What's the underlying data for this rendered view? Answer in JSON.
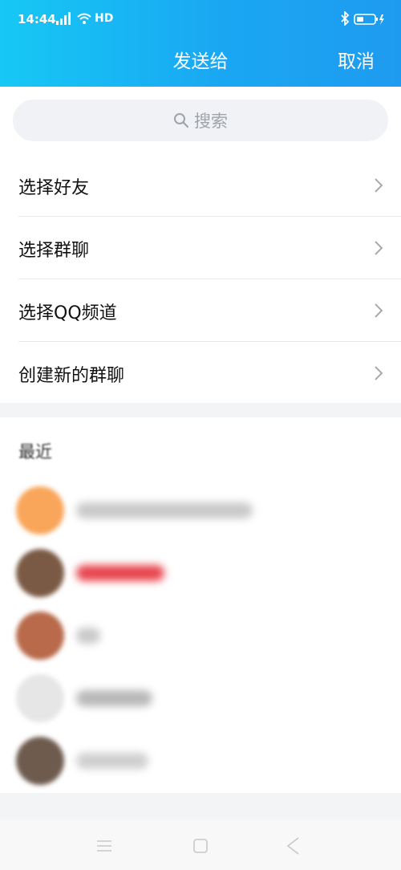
{
  "status_bar": {
    "time": "14:44",
    "network": "HD",
    "icons": [
      "signal-icon",
      "wifi-icon",
      "bluetooth-icon",
      "battery-icon",
      "charging-icon"
    ]
  },
  "header": {
    "title": "发送给",
    "cancel_label": "取消"
  },
  "search": {
    "placeholder": "搜索",
    "icon": "search-icon"
  },
  "menu": {
    "items": [
      {
        "label": "选择好友",
        "icon": "chevron-right-icon"
      },
      {
        "label": "选择群聊",
        "icon": "chevron-right-icon"
      },
      {
        "label": "选择QQ频道",
        "icon": "chevron-right-icon"
      },
      {
        "label": "创建新的群聊",
        "icon": "chevron-right-icon"
      }
    ]
  },
  "recent": {
    "title": "最近",
    "contacts_blurred": true,
    "avatar_colors": [
      "#f9a65a",
      "#7a5a44",
      "#b86a4a",
      "#d8d8d8",
      "#6e5b4e"
    ],
    "accent_color": "#e8464f"
  },
  "colors": {
    "header_gradient_start": "#16c8f5",
    "header_gradient_end": "#1e9bf0",
    "search_bg": "#f0f2f5",
    "section_gap": "#f3f4f6"
  },
  "navigation_bar": {
    "icons": [
      "menu-icon",
      "home-square-icon",
      "back-triangle-icon"
    ]
  }
}
